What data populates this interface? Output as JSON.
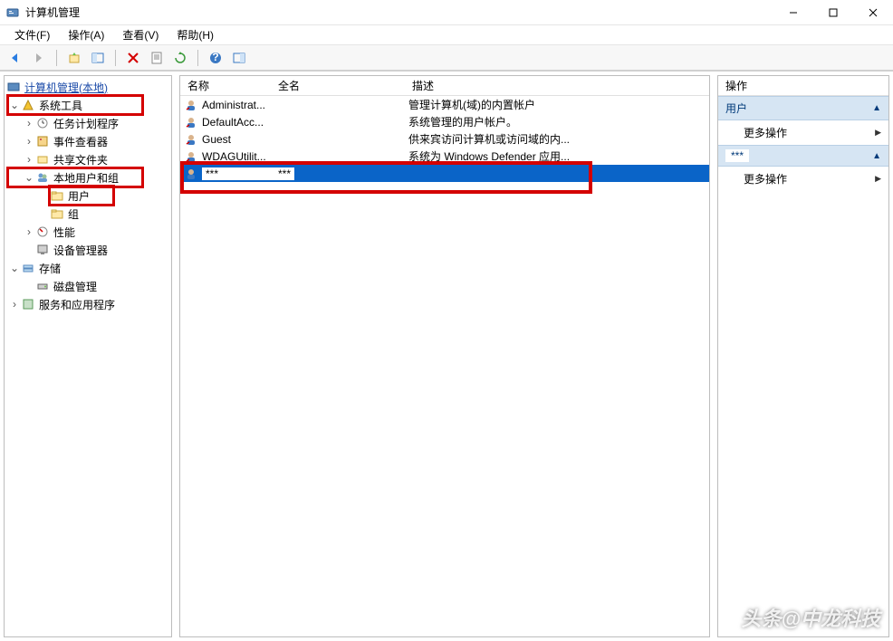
{
  "window": {
    "title": "计算机管理",
    "buttons": {
      "min": "–",
      "max": "☐",
      "close": "✕"
    }
  },
  "menu": {
    "file": "文件(F)",
    "action": "操作(A)",
    "view": "查看(V)",
    "help": "帮助(H)"
  },
  "tree": {
    "root": "计算机管理(本地)",
    "system_tools": "系统工具",
    "task_scheduler": "任务计划程序",
    "event_viewer": "事件查看器",
    "shared_folders": "共享文件夹",
    "local_users_groups": "本地用户和组",
    "users": "用户",
    "groups": "组",
    "performance": "性能",
    "device_manager": "设备管理器",
    "storage": "存储",
    "disk_management": "磁盘管理",
    "services_apps": "服务和应用程序"
  },
  "list": {
    "columns": {
      "name": "名称",
      "fullname": "全名",
      "desc": "描述"
    },
    "rows": [
      {
        "name": "Administrat...",
        "desc": "管理计算机(域)的内置帐户"
      },
      {
        "name": "DefaultAcc...",
        "desc": "系统管理的用户帐户。"
      },
      {
        "name": "Guest",
        "desc": "供来宾访问计算机或访问域的内..."
      },
      {
        "name": "WDAGUtilit...",
        "desc": "系统为 Windows Defender 应用..."
      },
      {
        "name": "***",
        "full": "***",
        "desc": ""
      }
    ]
  },
  "actions": {
    "header": "操作",
    "section1": "用户",
    "more1": "更多操作",
    "section2": "***",
    "more2": "更多操作"
  },
  "watermark": "头条@中龙科技"
}
